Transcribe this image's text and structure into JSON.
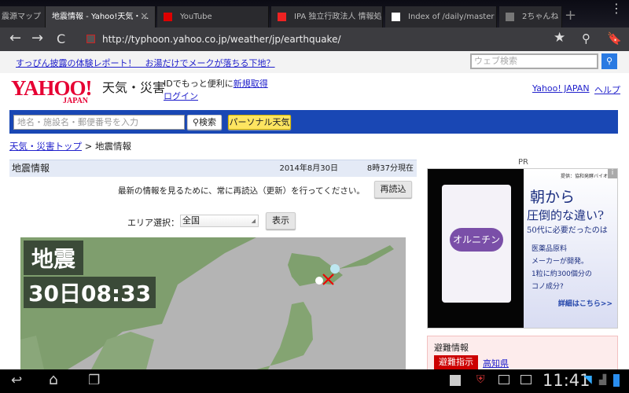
{
  "browser": {
    "tabs": [
      {
        "label": "震源マップ",
        "active": false
      },
      {
        "label": "地震情報 - Yahoo!天気・…",
        "active": true
      },
      {
        "label": "YouTube",
        "active": false
      },
      {
        "label": "IPA 独立行政法人 情報処…",
        "active": false
      },
      {
        "label": "Index of /daily/master",
        "active": false
      },
      {
        "label": "2ちゃんね",
        "active": false
      }
    ],
    "url": "http://typhoon.yahoo.co.jp/weather/jp/earthquake/"
  },
  "promo": {
    "text": "すっぴん披露の体験レポート！　お湯だけでメークが落ちる下地？",
    "search_placeholder": "ウェブ検索"
  },
  "header": {
    "logo": "YAHOO!",
    "logo_sub": "JAPAN",
    "service": "天気・災害",
    "id_text": "IDでもっと便利に",
    "signup": "新規取得",
    "login": "ログイン",
    "yahoo_japan": "Yahoo! JAPAN",
    "help": "ヘルプ"
  },
  "searchbar": {
    "placeholder": "地名・施設名・郵便番号を入力",
    "search": "検索",
    "personal": "パーソナル天気"
  },
  "breadcrumb": {
    "top": "天気・災害トップ",
    "sep": ">",
    "current": "地震情報"
  },
  "main": {
    "title": "地震情報",
    "date": "2014年8月30日",
    "time": "8時37分現在",
    "notice": "最新の情報を見るために、常に再読込（更新）を行ってください。",
    "reload": "再読込",
    "area_label": "エリア選択：",
    "area_value": "全国",
    "show": "表示",
    "map_title": "地震",
    "map_time": "30日08:33"
  },
  "ad": {
    "pr": "PR",
    "provider": "提供：協和発酵バイオ",
    "line1": "朝から",
    "line2": "圧倒的な違い?",
    "line3": "50代に必要だったのは",
    "line4": "医薬品原料",
    "line5": "メーカーが開発。",
    "line6": "1粒に約300個分の",
    "line7": "コノ成分?",
    "more": "詳細はこちら>>",
    "product": "オルニチン"
  },
  "evac": {
    "title": "避難情報",
    "badge": "避難指示",
    "pref": "高知県"
  },
  "status": {
    "time": "11:41"
  }
}
